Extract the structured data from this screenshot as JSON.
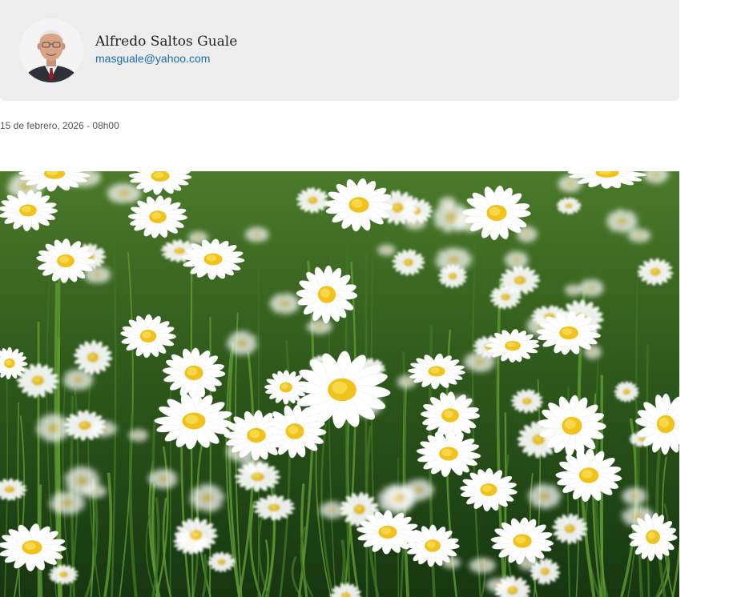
{
  "author": {
    "name": "Alfredo Saltos Guale",
    "email": "masguale@yahoo.com"
  },
  "article": {
    "date": "15 de febrero, 2026 - 08h00"
  },
  "colors": {
    "card_background": "#ededed",
    "link": "#1a6fb0",
    "meta_text": "#555555",
    "name_text": "#222222"
  },
  "images": {
    "avatar": "portrait-photo",
    "hero": "daisy-field-photo"
  }
}
